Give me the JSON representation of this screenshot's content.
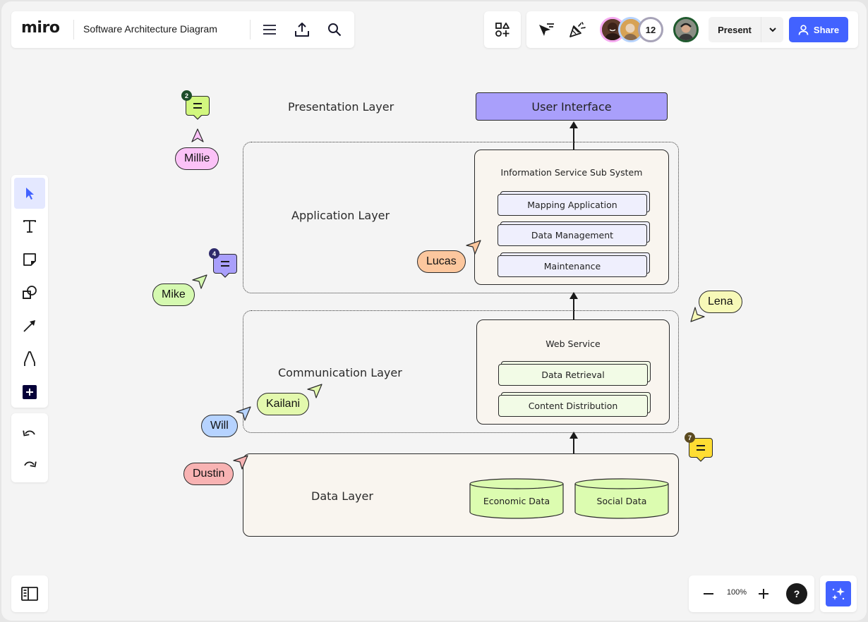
{
  "app": {
    "logo": "miro",
    "board_title": "Software Architecture Diagram"
  },
  "header": {
    "left_icons": [
      "menu-icon",
      "export-upload-icon",
      "search-icon"
    ],
    "right_icons": [
      "shapes-apps-icon",
      "cursor-filter-icon",
      "celebrate-confetti-icon"
    ],
    "collaborators": [
      {
        "name": "collaborator-1",
        "ring_color": "#f5a9f0"
      },
      {
        "name": "collaborator-2",
        "ring_color": "#b6d3ff"
      }
    ],
    "collaborator_overflow_count": "12",
    "current_user": {
      "ring_color": "#1f5a2e"
    },
    "present_label": "Present",
    "share_label": "Share",
    "accent_color": "#4262ff"
  },
  "toolbar": {
    "tools": [
      {
        "name": "select",
        "icon": "cursor-icon",
        "active": true
      },
      {
        "name": "text",
        "icon": "text-icon",
        "active": false
      },
      {
        "name": "sticky-note",
        "icon": "sticky-note-icon",
        "active": false
      },
      {
        "name": "shapes",
        "icon": "shapes-icon",
        "active": false
      },
      {
        "name": "connection-line",
        "icon": "arrow-line-icon",
        "active": false
      },
      {
        "name": "pen",
        "icon": "pen-icon",
        "active": false
      },
      {
        "name": "more-tools",
        "icon": "plus-icon",
        "active": false
      }
    ],
    "history": [
      "undo-icon",
      "redo-icon"
    ]
  },
  "bottom": {
    "zoom_level": "100%",
    "help_label": "?",
    "icons": [
      "side-panel-icon",
      "zoom-out-icon",
      "zoom-in-icon",
      "ai-sparkle-icon"
    ]
  },
  "diagram": {
    "layers": {
      "presentation": "Presentation Layer",
      "application": "Application Layer",
      "communication": "Communication Layer",
      "data": "Data Layer"
    },
    "user_interface": "User Interface",
    "info_subsystem": {
      "title": "Information Service Sub System",
      "items": [
        "Mapping Application",
        "Data Management",
        "Maintenance"
      ]
    },
    "web_service": {
      "title": "Web Service",
      "items": [
        "Data Retrieval",
        "Content Distribution"
      ]
    },
    "databases": [
      "Economic Data",
      "Social Data"
    ],
    "colors": {
      "ui_box": "#a99ffb",
      "subsystem_item": "#efeffd",
      "web_item": "#f2fbe6",
      "database": "#dcfcb0"
    }
  },
  "cursors": [
    {
      "name": "Millie",
      "color": "#fbc2f7"
    },
    {
      "name": "Mike",
      "color": "#d5f9b0"
    },
    {
      "name": "Lucas",
      "color": "#fcc79e"
    },
    {
      "name": "Lena",
      "color": "#f7f9b8"
    },
    {
      "name": "Kailani",
      "color": "#e3f9ad"
    },
    {
      "name": "Will",
      "color": "#b6d3ff"
    },
    {
      "name": "Dustin",
      "color": "#f8b3b3"
    }
  ],
  "comments": [
    {
      "count": "2",
      "color": "#d2f77f",
      "badge_color": "#1e4d2b"
    },
    {
      "count": "4",
      "color": "#a99ffb",
      "badge_color": "#2e2a6b"
    },
    {
      "count": "7",
      "color": "#ffdd33",
      "badge_color": "#5b4a1f"
    }
  ]
}
